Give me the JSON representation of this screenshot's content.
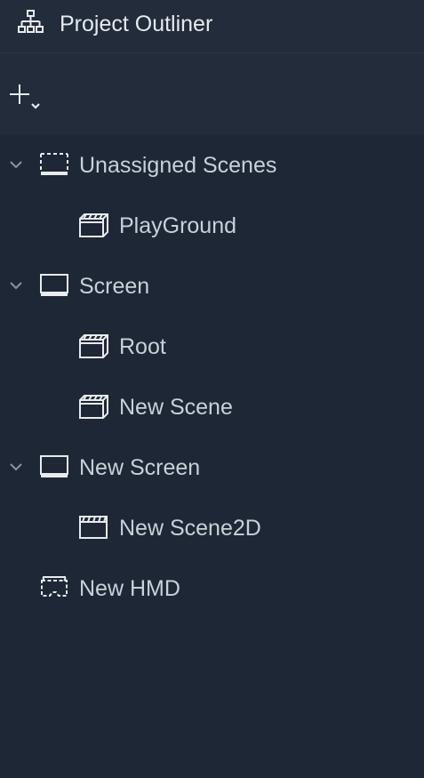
{
  "header": {
    "title": "Project Outliner",
    "icon": "hierarchy-icon"
  },
  "toolbar": {
    "add_icon": "plus-dropdown-icon"
  },
  "tree": {
    "items": [
      {
        "label": "Unassigned Scenes",
        "icon": "unassigned-screen-icon",
        "level": 0,
        "expanded": true
      },
      {
        "label": "PlayGround",
        "icon": "scene-3d-icon",
        "level": 1
      },
      {
        "label": "Screen",
        "icon": "screen-icon",
        "level": 0,
        "expanded": true
      },
      {
        "label": "Root",
        "icon": "scene-3d-icon",
        "level": 1
      },
      {
        "label": "New Scene",
        "icon": "scene-3d-icon",
        "level": 1
      },
      {
        "label": "New Screen",
        "icon": "screen-icon",
        "level": 0,
        "expanded": true
      },
      {
        "label": "New Scene2D",
        "icon": "scene-2d-icon",
        "level": 1
      },
      {
        "label": "New HMD",
        "icon": "hmd-icon",
        "level": 0
      }
    ]
  },
  "colors": {
    "background": "#1e2735",
    "header_background": "#222c3a",
    "text": "#c9d0d9",
    "icon": "#e8ebef"
  }
}
